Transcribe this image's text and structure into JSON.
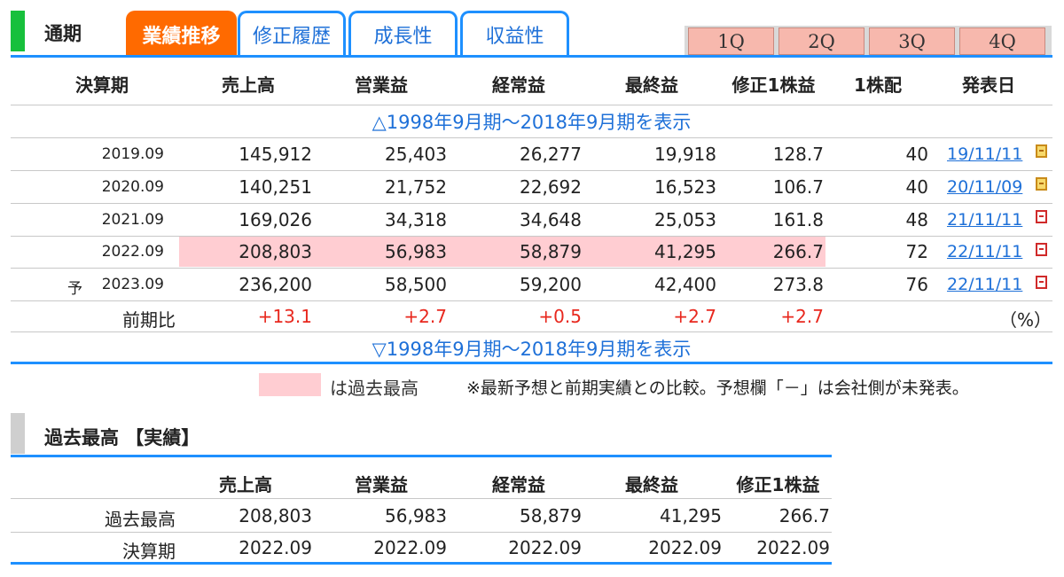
{
  "header": {
    "title": "通期",
    "tabs": [
      "業績推移",
      "修正履歴",
      "成長性",
      "収益性"
    ],
    "quarters": [
      "1Q",
      "2Q",
      "3Q",
      "4Q"
    ]
  },
  "table": {
    "columns": [
      "決算期",
      "売上高",
      "営業益",
      "経常益",
      "最終益",
      "修正1株益",
      "1株配",
      "発表日"
    ],
    "toggle_top": "△1998年9月期～2018年9月期を表示",
    "toggle_bottom": "▽1998年9月期～2018年9月期を表示",
    "rows": [
      {
        "prefix": "",
        "period": "2019.09",
        "sales": "145,912",
        "op": "25,403",
        "ord": "26,277",
        "net": "19,918",
        "eps": "128.7",
        "div": "40",
        "date": "19/11/11",
        "icon": "calendar-icon"
      },
      {
        "prefix": "",
        "period": "2020.09",
        "sales": "140,251",
        "op": "21,752",
        "ord": "22,692",
        "net": "16,523",
        "eps": "106.7",
        "div": "40",
        "date": "20/11/09",
        "icon": "calendar-icon"
      },
      {
        "prefix": "",
        "period": "2021.09",
        "sales": "169,026",
        "op": "34,318",
        "ord": "34,648",
        "net": "25,053",
        "eps": "161.8",
        "div": "48",
        "date": "21/11/11",
        "icon": "pdf-icon"
      },
      {
        "prefix": "",
        "period": "2022.09",
        "sales": "208,803",
        "op": "56,983",
        "ord": "58,879",
        "net": "41,295",
        "eps": "266.7",
        "div": "72",
        "date": "22/11/11",
        "icon": "pdf-icon"
      },
      {
        "prefix": "予",
        "period": "2023.09",
        "sales": "236,200",
        "op": "58,500",
        "ord": "59,200",
        "net": "42,400",
        "eps": "273.8",
        "div": "76",
        "date": "22/11/11",
        "icon": "pdf-icon"
      }
    ],
    "comparison": {
      "label": "前期比",
      "sales": "+13.1",
      "op": "+2.7",
      "ord": "+0.5",
      "net": "+2.7",
      "eps": "+2.7",
      "unit": "（%）"
    }
  },
  "legend": {
    "label": "は過去最高",
    "note": "※最新予想と前期実績との比較。予想欄「－」は会社側が未発表。"
  },
  "record": {
    "title": "過去最高 【実績】",
    "columns": [
      "売上高",
      "営業益",
      "経常益",
      "最終益",
      "修正1株益"
    ],
    "rows": [
      {
        "label": "過去最高",
        "values": [
          "208,803",
          "56,983",
          "58,879",
          "41,295",
          "266.7"
        ]
      },
      {
        "label": "決算期",
        "values": [
          "2022.09",
          "2022.09",
          "2022.09",
          "2022.09",
          "2022.09"
        ]
      }
    ]
  },
  "colors": {
    "accent_blue": "#1e90ff",
    "tab_active": "#ff6a00",
    "highlight_pink": "#ffcdd2",
    "positive_red": "#e8281e",
    "section_green": "#17c03c"
  }
}
